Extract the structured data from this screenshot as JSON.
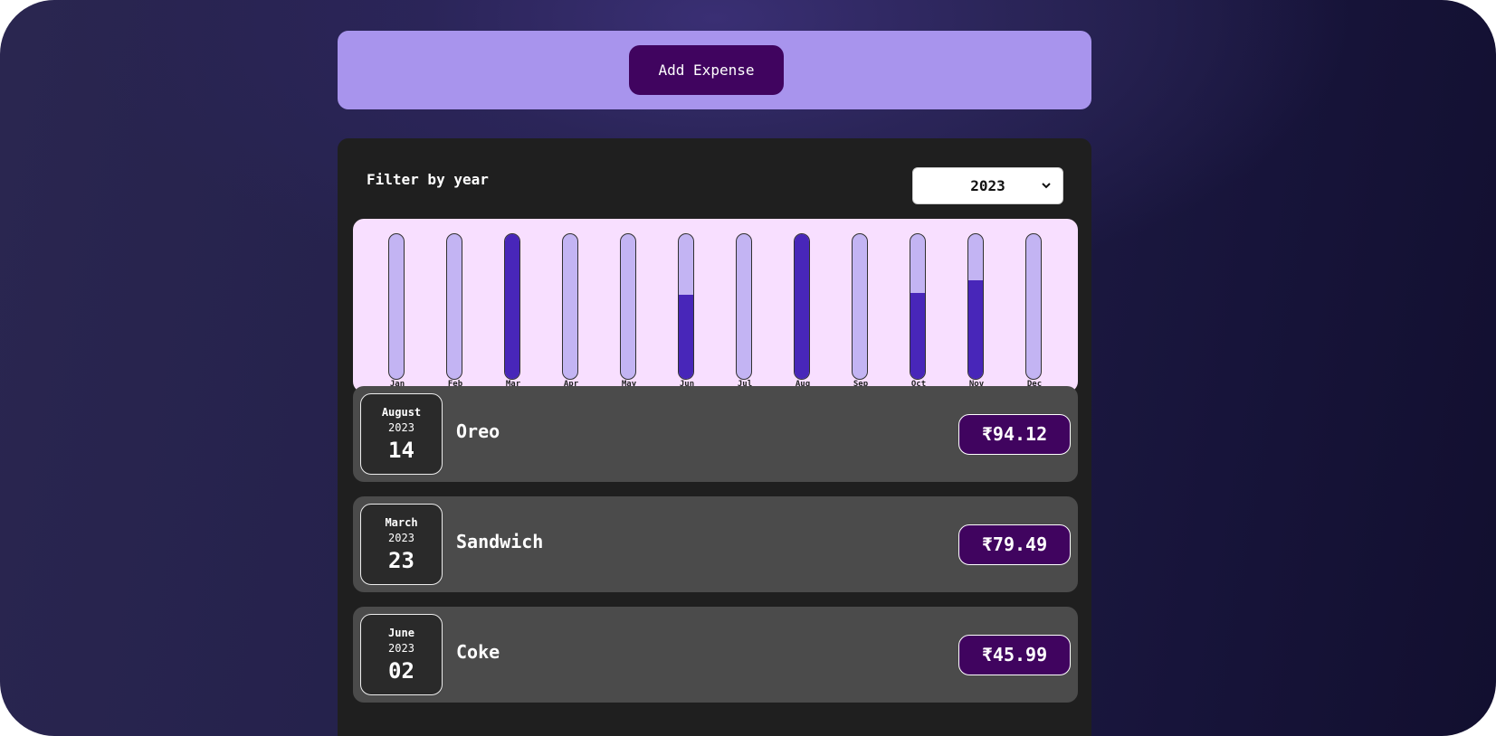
{
  "new_expense": {
    "button_label": "Add Expense"
  },
  "filter": {
    "label": "Filter by year",
    "selected_year": "2023"
  },
  "chart_data": {
    "type": "bar",
    "categories": [
      "Jan",
      "Feb",
      "Mar",
      "Apr",
      "May",
      "Jun",
      "Jul",
      "Aug",
      "Sep",
      "Oct",
      "Nov",
      "Dec"
    ],
    "values": [
      0,
      0,
      79.49,
      0,
      0,
      45.99,
      0,
      94.12,
      0,
      47,
      54,
      0
    ],
    "ylim": [
      0,
      79.49
    ]
  },
  "expenses": [
    {
      "month": "August",
      "year": "2023",
      "day": "14",
      "title": "Oreo",
      "amount": "₹94.12"
    },
    {
      "month": "March",
      "year": "2023",
      "day": "23",
      "title": "Sandwich",
      "amount": "₹79.49"
    },
    {
      "month": "June",
      "year": "2023",
      "day": "02",
      "title": "Coke",
      "amount": "₹45.99"
    }
  ],
  "colors": {
    "accent": "#40045f",
    "panel": "#a894ed",
    "bar_fill": "#4826b9",
    "bar_track": "#c3b4f3",
    "chart_bg": "#f8dfff"
  }
}
